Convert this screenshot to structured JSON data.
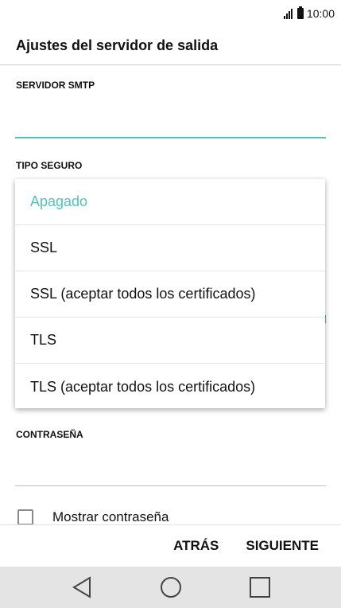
{
  "status_bar": {
    "time": "10:00"
  },
  "header": {
    "title": "Ajustes del servidor de salida"
  },
  "form": {
    "smtp_label": "SERVIDOR SMTP",
    "smtp_value": "",
    "security_label": "TIPO SEGURO",
    "password_label": "CONTRASEÑA",
    "password_value": "",
    "show_password_label": "Mostrar contraseña"
  },
  "dropdown": {
    "options": [
      {
        "label": "Apagado",
        "selected": true
      },
      {
        "label": "SSL",
        "selected": false
      },
      {
        "label": "SSL (aceptar todos los certificados)",
        "selected": false
      },
      {
        "label": "TLS",
        "selected": false
      },
      {
        "label": "TLS (aceptar todos los certificados)",
        "selected": false
      }
    ]
  },
  "buttons": {
    "back": "ATRÁS",
    "next": "SIGUIENTE"
  },
  "colors": {
    "accent": "#4fc4b9",
    "nav_bar": "#e4e4e4"
  }
}
